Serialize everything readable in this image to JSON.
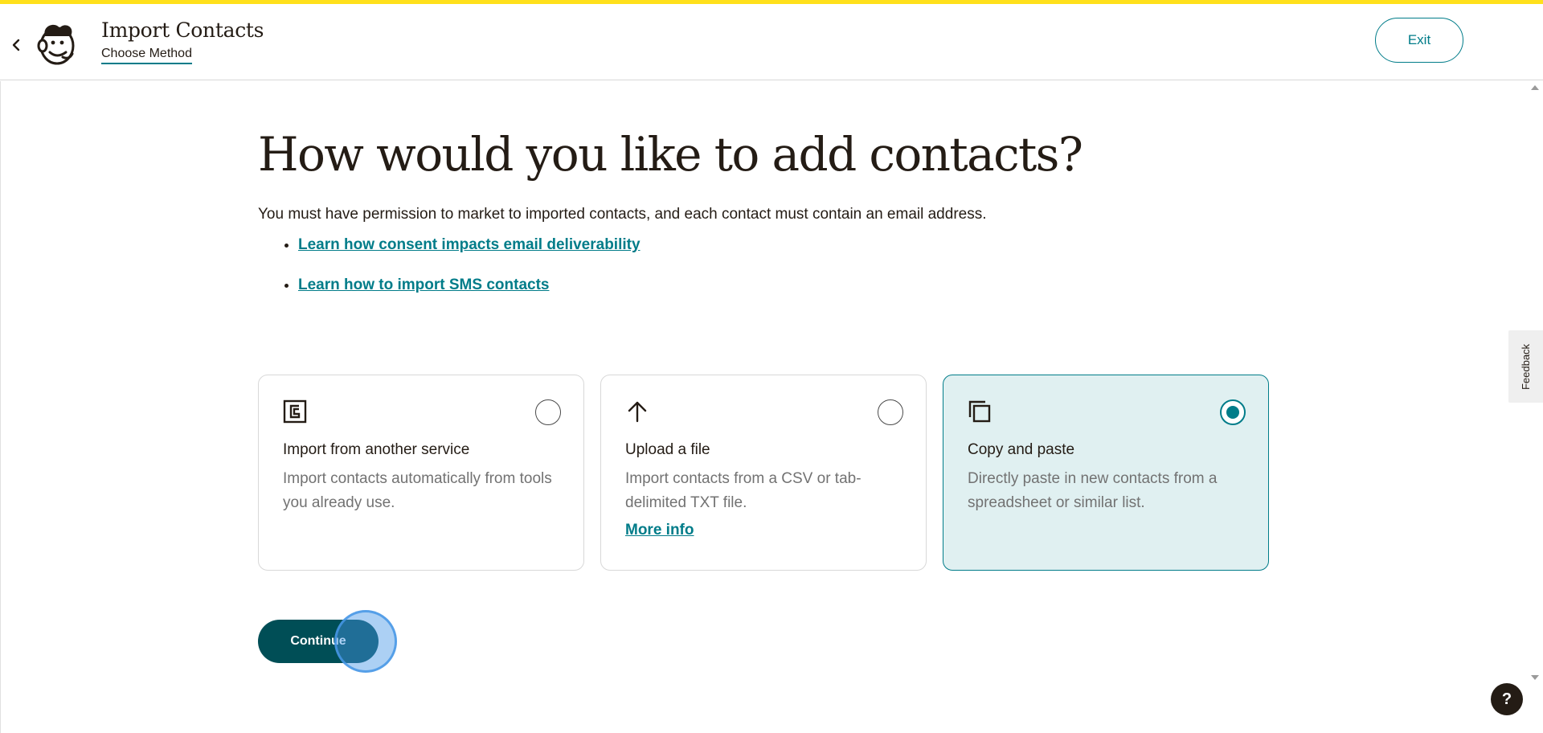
{
  "header": {
    "title": "Import Contacts",
    "subtitle": "Choose Method",
    "exit_label": "Exit",
    "back_icon": "chevron-left-icon",
    "logo_icon": "mailchimp-freddie-logo"
  },
  "main": {
    "headline": "How would you like to add contacts?",
    "intro": "You must have permission to market to imported contacts, and each contact must contain an email address.",
    "links": [
      {
        "label": "Learn how consent impacts email deliverability"
      },
      {
        "label": "Learn how to import SMS contacts"
      }
    ]
  },
  "methods": [
    {
      "icon": "import-service-icon",
      "title": "Import from another service",
      "description": "Import contacts automatically from tools you already use.",
      "selected": false
    },
    {
      "icon": "upload-arrow-icon",
      "title": "Upload a file",
      "description": "Import contacts from a CSV or tab-delimited TXT file.",
      "link": "More info",
      "selected": false
    },
    {
      "icon": "copy-icon",
      "title": "Copy and paste",
      "description": "Directly paste in new contacts from a spreadsheet or similar list.",
      "selected": true
    }
  ],
  "actions": {
    "continue_label": "Continue"
  },
  "widgets": {
    "feedback_label": "Feedback",
    "help_label": "?"
  },
  "colors": {
    "accent": "#007c89",
    "accent_dark": "#004e56",
    "brand_yellow": "#ffe01b",
    "selected_bg": "#e0f0f1"
  }
}
